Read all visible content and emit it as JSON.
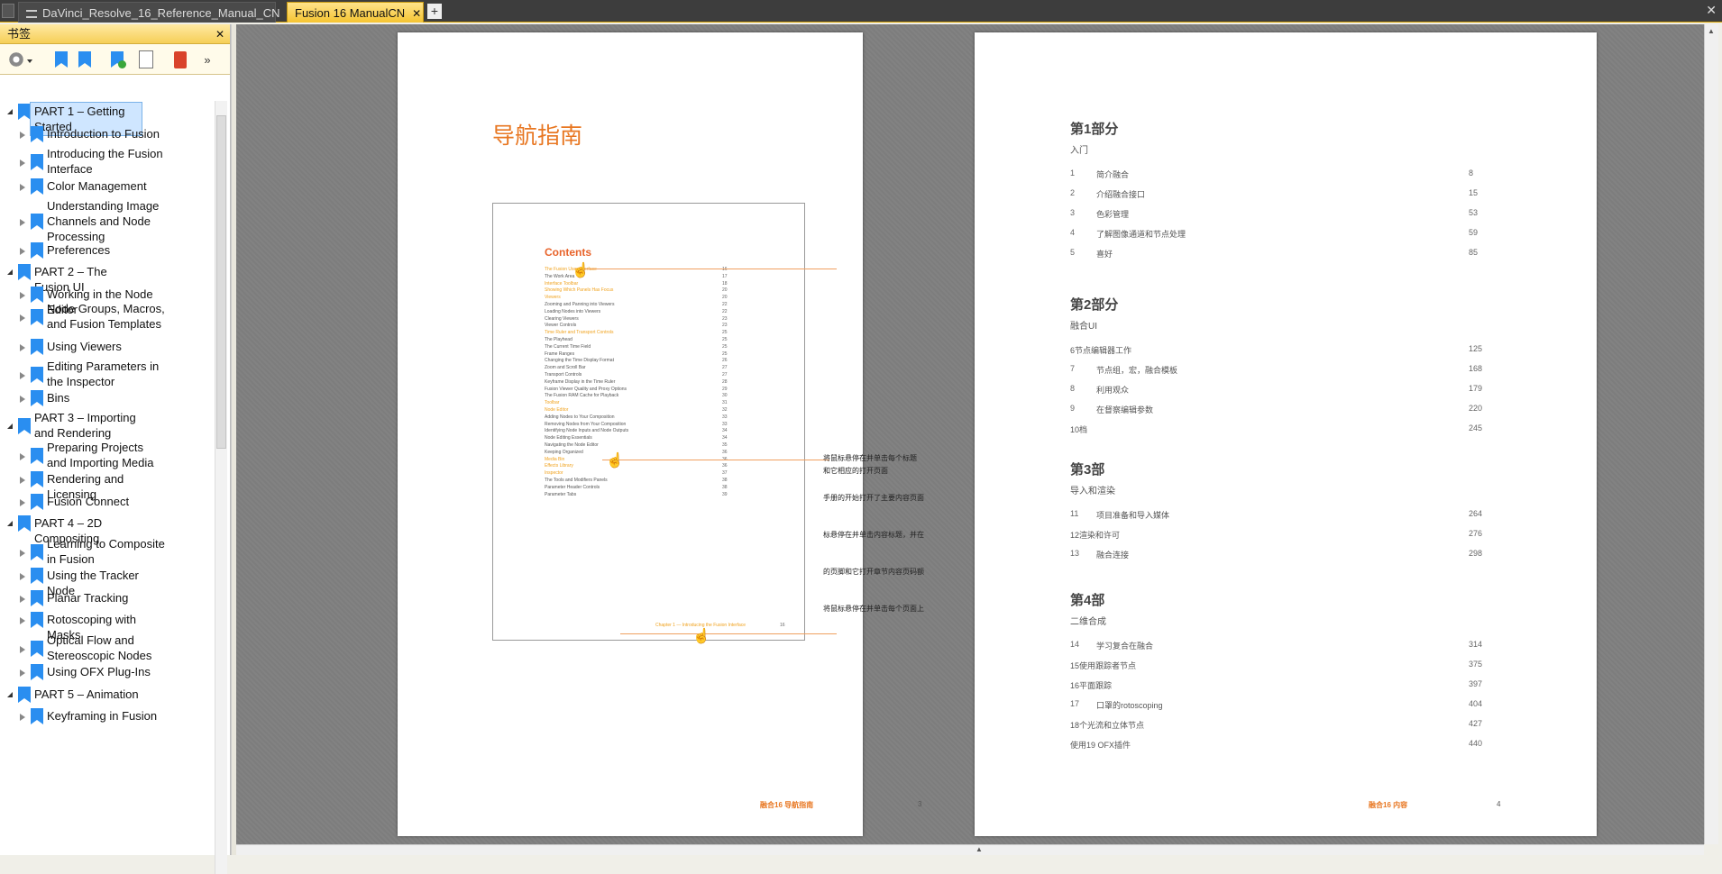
{
  "tabs": [
    {
      "label": "DaVinci_Resolve_16_Reference_Manual_CN"
    },
    {
      "label": "Fusion 16 ManualCN"
    }
  ],
  "sidebar": {
    "title": "书签",
    "close_icon": "✕",
    "items": [
      {
        "label": "PART 1 – Getting Started",
        "level": 0
      },
      {
        "label": "Introduction to Fusion",
        "level": 1
      },
      {
        "label": "Introducing the Fusion Interface",
        "level": 1
      },
      {
        "label": "Color Management",
        "level": 1
      },
      {
        "label": "Understanding Image Channels and Node Processing",
        "level": 1
      },
      {
        "label": "Preferences",
        "level": 1
      },
      {
        "label": "PART 2 – The Fusion UI",
        "level": 0
      },
      {
        "label": "Working in the Node Editor",
        "level": 1
      },
      {
        "label": "Node Groups, Macros, and Fusion Templates",
        "level": 1
      },
      {
        "label": "Using Viewers",
        "level": 1
      },
      {
        "label": "Editing Parameters in the Inspector",
        "level": 1
      },
      {
        "label": "Bins",
        "level": 1
      },
      {
        "label": "PART 3 – Importing and Rendering",
        "level": 0
      },
      {
        "label": "Preparing Projects and Importing Media",
        "level": 1
      },
      {
        "label": "Rendering and Licensing",
        "level": 1
      },
      {
        "label": "Fusion Connect",
        "level": 1
      },
      {
        "label": "PART 4 – 2D Compositing",
        "level": 0
      },
      {
        "label": "Learning to Composite in Fusion",
        "level": 1
      },
      {
        "label": "Using the Tracker Node",
        "level": 1
      },
      {
        "label": "Planar Tracking",
        "level": 1
      },
      {
        "label": "Rotoscoping with Masks",
        "level": 1
      },
      {
        "label": "Optical Flow and Stereoscopic Nodes",
        "level": 1
      },
      {
        "label": "Using OFX Plug-Ins",
        "level": 1
      },
      {
        "label": "PART 5 – Animation",
        "level": 0
      },
      {
        "label": "Keyframing in Fusion",
        "level": 1
      }
    ]
  },
  "page_left": {
    "title": "导航指南",
    "contents_title": "Contents",
    "contents": [
      {
        "t": "The Fusion User Interface",
        "n": "16",
        "o": true
      },
      {
        "t": "The Work Area",
        "n": "17",
        "o": false
      },
      {
        "t": "Interface Toolbar",
        "n": "18",
        "o": true
      },
      {
        "t": "Showing Which Panels Has Focus",
        "n": "20",
        "o": true
      },
      {
        "t": "Viewers",
        "n": "20",
        "o": true
      },
      {
        "t": "Zooming and Panning into Viewers",
        "n": "22",
        "o": false
      },
      {
        "t": "Loading Nodes into Viewers",
        "n": "22",
        "o": false
      },
      {
        "t": "Clearing Viewers",
        "n": "23",
        "o": false
      },
      {
        "t": "Viewer Controls",
        "n": "23",
        "o": false
      },
      {
        "t": "Time Ruler and Transport Controls",
        "n": "25",
        "o": true
      },
      {
        "t": "The Playhead",
        "n": "25",
        "o": false
      },
      {
        "t": "The Current Time Field",
        "n": "25",
        "o": false
      },
      {
        "t": "Frame Ranges",
        "n": "25",
        "o": false
      },
      {
        "t": "Changing the Time Display Format",
        "n": "26",
        "o": false
      },
      {
        "t": "Zoom and Scroll Bar",
        "n": "27",
        "o": false
      },
      {
        "t": "Transport Controls",
        "n": "27",
        "o": false
      },
      {
        "t": "Keyframe Display in the Time Ruler",
        "n": "28",
        "o": false
      },
      {
        "t": "Fusion Viewer Quality and Proxy Options",
        "n": "29",
        "o": false
      },
      {
        "t": "The Fusion RAM Cache for Playback",
        "n": "30",
        "o": false
      },
      {
        "t": "Toolbar",
        "n": "31",
        "o": true
      },
      {
        "t": "Node Editor",
        "n": "32",
        "o": true
      },
      {
        "t": "Adding Nodes to Your Composition",
        "n": "33",
        "o": false
      },
      {
        "t": "Removing Nodes from Your Composition",
        "n": "33",
        "o": false
      },
      {
        "t": "Identifying Node Inputs and Node Outputs",
        "n": "34",
        "o": false
      },
      {
        "t": "Node Editing Essentials",
        "n": "34",
        "o": false
      },
      {
        "t": "Navigating the Node Editor",
        "n": "35",
        "o": false
      },
      {
        "t": "Keeping Organized",
        "n": "36",
        "o": false
      },
      {
        "t": "Media Bin",
        "n": "36",
        "o": true
      },
      {
        "t": "Effects Library",
        "n": "36",
        "o": true
      },
      {
        "t": "Inspector",
        "n": "37",
        "o": true
      },
      {
        "t": "The Tools and Modifiers Panels",
        "n": "38",
        "o": false
      },
      {
        "t": "Parameter Header Controls",
        "n": "38",
        "o": false
      },
      {
        "t": "Parameter Tabs",
        "n": "39",
        "o": false
      }
    ],
    "contents_footer": "Chapter 1 — Introducing the Fusion Interface",
    "contents_footer_num": "16",
    "annotations": [
      "将鼠标悬停在并单击每个标题",
      "和它相应的打开页面",
      "手册的开始打开了主要内容页面",
      "标悬停在并单击内容标题，并在",
      "的页脚和它打开章节内容页码额",
      "将鼠标悬停在并单击每个页面上"
    ],
    "footer": "融合16 导航指南",
    "page_num": "3"
  },
  "page_right": {
    "parts": [
      {
        "heading": "第1部分",
        "sub": "入门",
        "rows": [
          {
            "n": "1",
            "t": "简介融合",
            "p": "8"
          },
          {
            "n": "2",
            "t": "介绍融合接口",
            "p": "15"
          },
          {
            "n": "3",
            "t": "色彩管理",
            "p": "53"
          },
          {
            "n": "4",
            "t": "了解图像通道和节点处理",
            "p": "59"
          },
          {
            "n": "5",
            "t": "喜好",
            "p": "85"
          }
        ]
      },
      {
        "heading": "第2部分",
        "sub": "融合UI",
        "rows": [
          {
            "n": "",
            "t": "6节点编辑器工作",
            "p": "125"
          },
          {
            "n": "7",
            "t": "节点组，宏，融合模板",
            "p": "168"
          },
          {
            "n": "8",
            "t": "利用观众",
            "p": "179"
          },
          {
            "n": "9",
            "t": "在督察编辑参数",
            "p": "220"
          },
          {
            "n": "",
            "t": "10档",
            "p": "245"
          }
        ]
      },
      {
        "heading": "第3部",
        "sub": "导入和渲染",
        "rows": [
          {
            "n": "11",
            "t": "项目准备和导入媒体",
            "p": "264"
          },
          {
            "n": "",
            "t": "12渲染和许可",
            "p": "276"
          },
          {
            "n": "13",
            "t": "融合连接",
            "p": "298"
          }
        ]
      },
      {
        "heading": "第4部",
        "sub": "二维合成",
        "rows": [
          {
            "n": "14",
            "t": "学习复合在融合",
            "p": "314"
          },
          {
            "n": "",
            "t": "15使用跟踪者节点",
            "p": "375"
          },
          {
            "n": "",
            "t": "16平面跟踪",
            "p": "397"
          },
          {
            "n": "17",
            "t": "口罩的rotoscoping",
            "p": "404"
          },
          {
            "n": "",
            "t": "18个光流和立体节点",
            "p": "427"
          },
          {
            "n": "",
            "t": "使用19 OFX插件",
            "p": "440"
          }
        ]
      }
    ],
    "footer": "融合16 内容",
    "page_num": "4"
  },
  "colors": {
    "accent": "#e87722",
    "tab_active": "#f5c431",
    "bookmark": "#2a8ef0"
  }
}
